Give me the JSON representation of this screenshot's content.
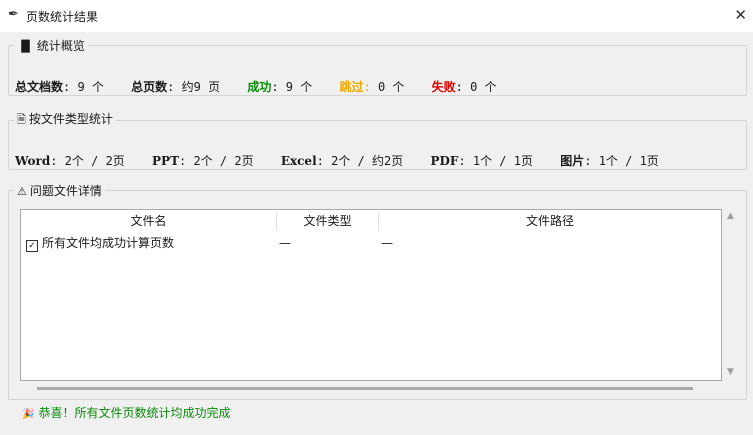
{
  "window": {
    "title": "页数统计结果",
    "close": "✕",
    "app_icon": "feather-icon"
  },
  "overview": {
    "legend": "统计概览",
    "total_docs_label": "总文档数",
    "total_docs_value": "9 个",
    "total_pages_label": "总页数",
    "total_pages_value": "约9 页",
    "success_label": "成功",
    "success_value": "9 个",
    "skipped_label": "跳过",
    "skipped_value": "0 个",
    "failed_label": "失败",
    "failed_value": "0 个"
  },
  "by_type": {
    "legend": "按文件类型统计",
    "items": [
      {
        "label": "Word",
        "value": "2个 / 2页"
      },
      {
        "label": "PPT",
        "value": "2个 / 2页"
      },
      {
        "label": "Excel",
        "value": "2个 / 约2页"
      },
      {
        "label": "PDF",
        "value": "1个 / 1页"
      },
      {
        "label": "图片",
        "value": "1个 / 1页"
      }
    ]
  },
  "issues": {
    "legend": "问题文件详情",
    "columns": [
      "文件名",
      "文件类型",
      "文件路径"
    ],
    "rows": [
      {
        "name": "所有文件均成功计算页数",
        "type": "—",
        "path": "—"
      }
    ]
  },
  "status": {
    "message": "恭喜！所有文件页数统计均成功完成"
  },
  "colors": {
    "success": "#0a8a0a",
    "skipped": "#f0a800",
    "failed": "#e00000"
  }
}
